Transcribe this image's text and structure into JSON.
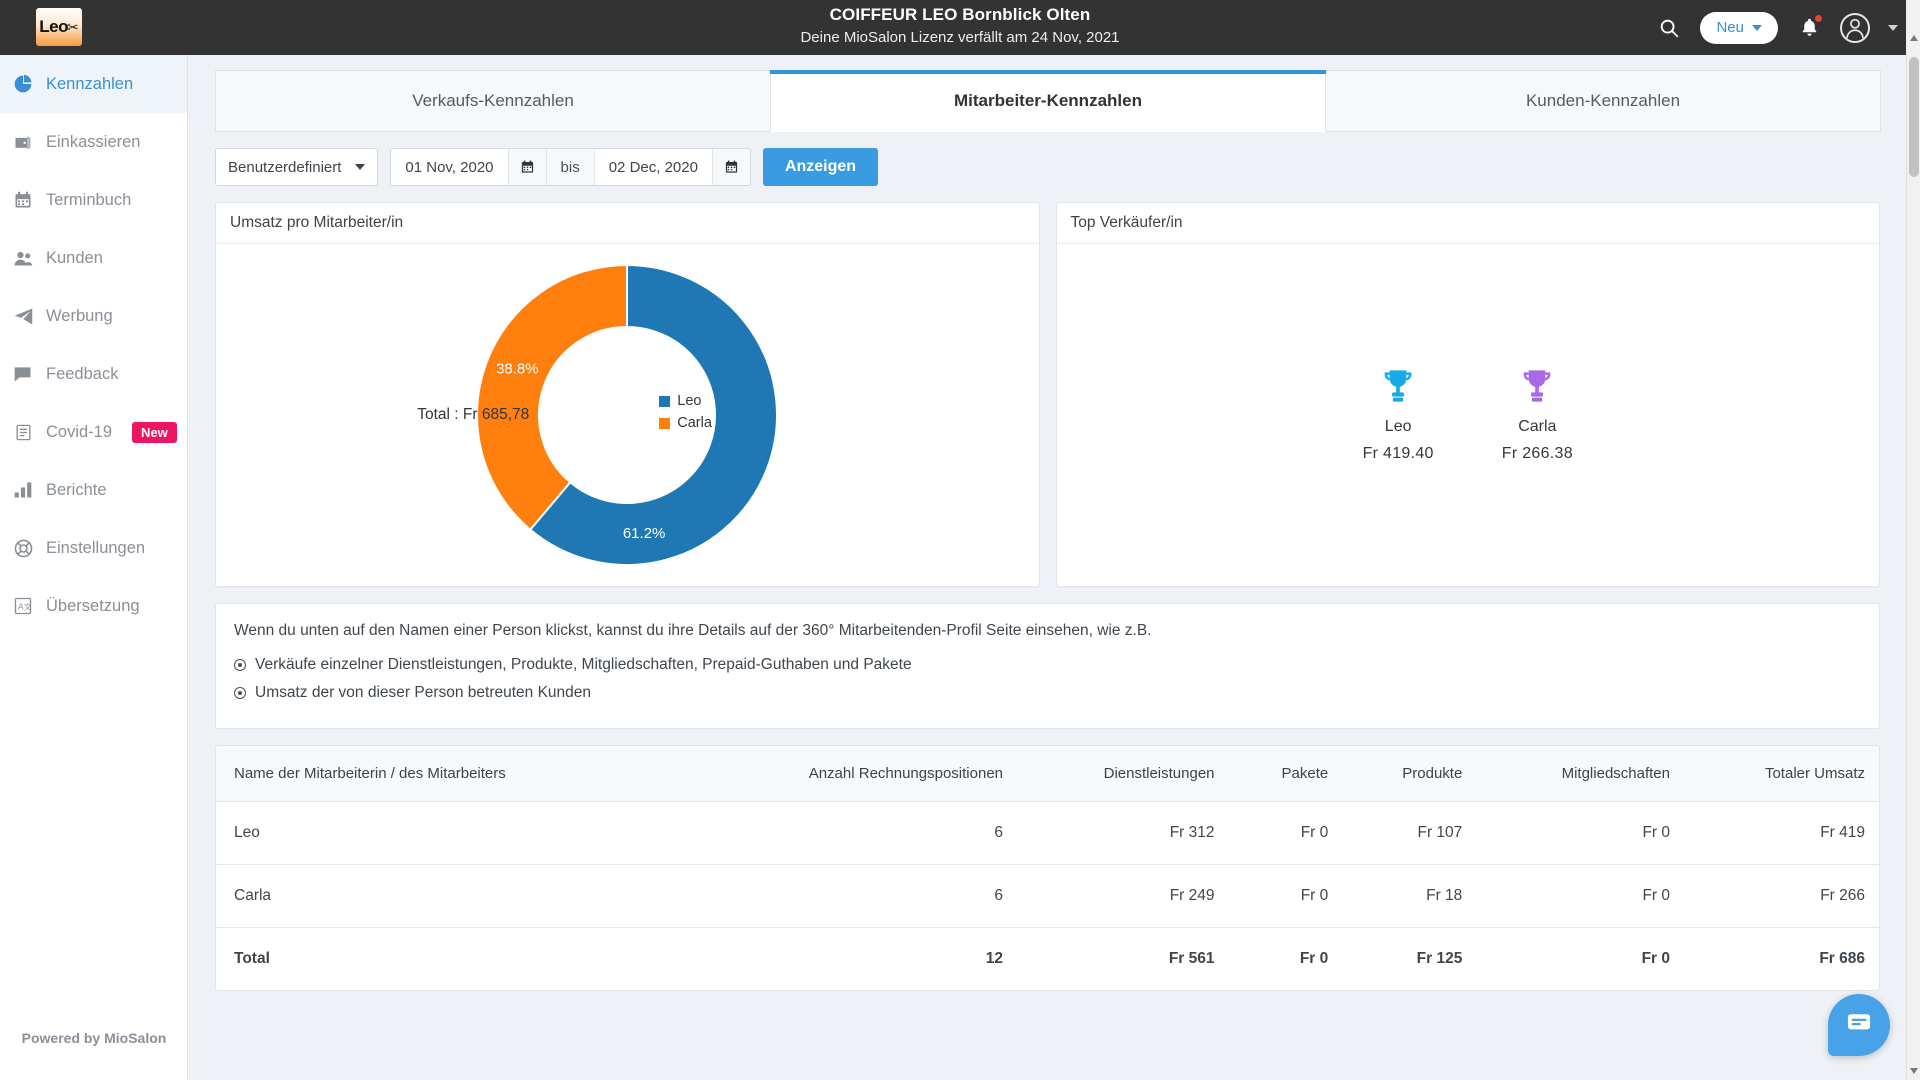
{
  "header": {
    "logo_text": "Leo",
    "title": "COIFFEUR LEO Bornblick Olten",
    "subtitle": "Deine MioSalon Lizenz verfällt am 24 Nov, 2021",
    "search_icon": "search-icon",
    "new_button": "Neu",
    "bell_icon": "bell-icon",
    "avatar_icon": "user-avatar-icon"
  },
  "sidebar": {
    "items": [
      {
        "label": "Kennzahlen",
        "icon": "pie-chart-icon",
        "active": true
      },
      {
        "label": "Einkassieren",
        "icon": "cash-register-icon",
        "active": false
      },
      {
        "label": "Terminbuch",
        "icon": "calendar-icon",
        "active": false
      },
      {
        "label": "Kunden",
        "icon": "users-icon",
        "active": false
      },
      {
        "label": "Werbung",
        "icon": "paper-plane-icon",
        "active": false
      },
      {
        "label": "Feedback",
        "icon": "comment-icon",
        "active": false
      },
      {
        "label": "Covid-19",
        "icon": "clipboard-icon",
        "active": false,
        "badge": "New"
      },
      {
        "label": "Berichte",
        "icon": "bar-chart-icon",
        "active": false
      },
      {
        "label": "Einstellungen",
        "icon": "lifebuoy-icon",
        "active": false
      },
      {
        "label": "Übersetzung",
        "icon": "translate-icon",
        "active": false
      }
    ],
    "footer": "Powered by MioSalon"
  },
  "tabs": [
    {
      "label": "Verkaufs-Kennzahlen",
      "active": false
    },
    {
      "label": "Mitarbeiter-Kennzahlen",
      "active": true
    },
    {
      "label": "Kunden-Kennzahlen",
      "active": false
    }
  ],
  "filters": {
    "range_select": "Benutzerdefiniert",
    "from_date": "01 Nov, 2020",
    "separator": "bis",
    "to_date": "02 Dec, 2020",
    "apply_button": "Anzeigen",
    "calendar_icon": "calendar-icon"
  },
  "cards": {
    "revenue_per_staff_title": "Umsatz pro Mitarbeiter/in",
    "top_sellers_title": "Top Verkäufer/in"
  },
  "chart_data": {
    "type": "pie",
    "title": "Umsatz pro Mitarbeiter/in",
    "donut": true,
    "center_label": "Total : Fr 685,78",
    "legend_position": "right",
    "categories": [
      "Leo",
      "Carla"
    ],
    "values": [
      419.4,
      266.38
    ],
    "percent_labels": [
      "61.2%",
      "38.8%"
    ],
    "colors": [
      "#1f77b4",
      "#ff7f0e"
    ],
    "total": 685.78,
    "currency": "Fr"
  },
  "top_sellers": [
    {
      "name": "Leo",
      "amount": "Fr  419.40",
      "trophy_color": "#18a9e8",
      "icon": "trophy-icon"
    },
    {
      "name": "Carla",
      "amount": "Fr  266.38",
      "trophy_color": "#a869e8",
      "icon": "trophy-icon"
    }
  ],
  "info": {
    "lead": "Wenn du unten auf den Namen einer Person klickst, kannst du ihre Details auf der 360° Mitarbeitenden-Profil Seite einsehen, wie z.B.",
    "bullets": [
      "Verkäufe einzelner Dienstleistungen, Produkte, Mitgliedschaften, Prepaid-Guthaben und Pakete",
      "Umsatz der von dieser Person betreuten Kunden"
    ]
  },
  "table": {
    "columns": [
      "Name der Mitarbeiterin / des Mitarbeiters",
      "Anzahl Rechnungspositionen",
      "Dienstleistungen",
      "Pakete",
      "Produkte",
      "Mitgliedschaften",
      "Totaler Umsatz"
    ],
    "rows": [
      {
        "name": "Leo",
        "positions": "6",
        "services": "Fr 312",
        "packages": "Fr 0",
        "products": "Fr 107",
        "memberships": "Fr 0",
        "total": "Fr 419"
      },
      {
        "name": "Carla",
        "positions": "6",
        "services": "Fr 249",
        "packages": "Fr 0",
        "products": "Fr 18",
        "memberships": "Fr 0",
        "total": "Fr 266"
      },
      {
        "name": "Total",
        "positions": "12",
        "services": "Fr 561",
        "packages": "Fr 0",
        "products": "Fr 125",
        "memberships": "Fr 0",
        "total": "Fr 686",
        "is_total": true
      }
    ]
  },
  "chat": {
    "icon": "chat-bubble-icon"
  },
  "colors": {
    "accent_blue": "#3a9ce0",
    "tab_active_bar": "#2e96d8",
    "topbar_bg": "#333333",
    "badge_pink": "#ec1561",
    "series_blue": "#1f77b4",
    "series_orange": "#ff7f0e"
  }
}
